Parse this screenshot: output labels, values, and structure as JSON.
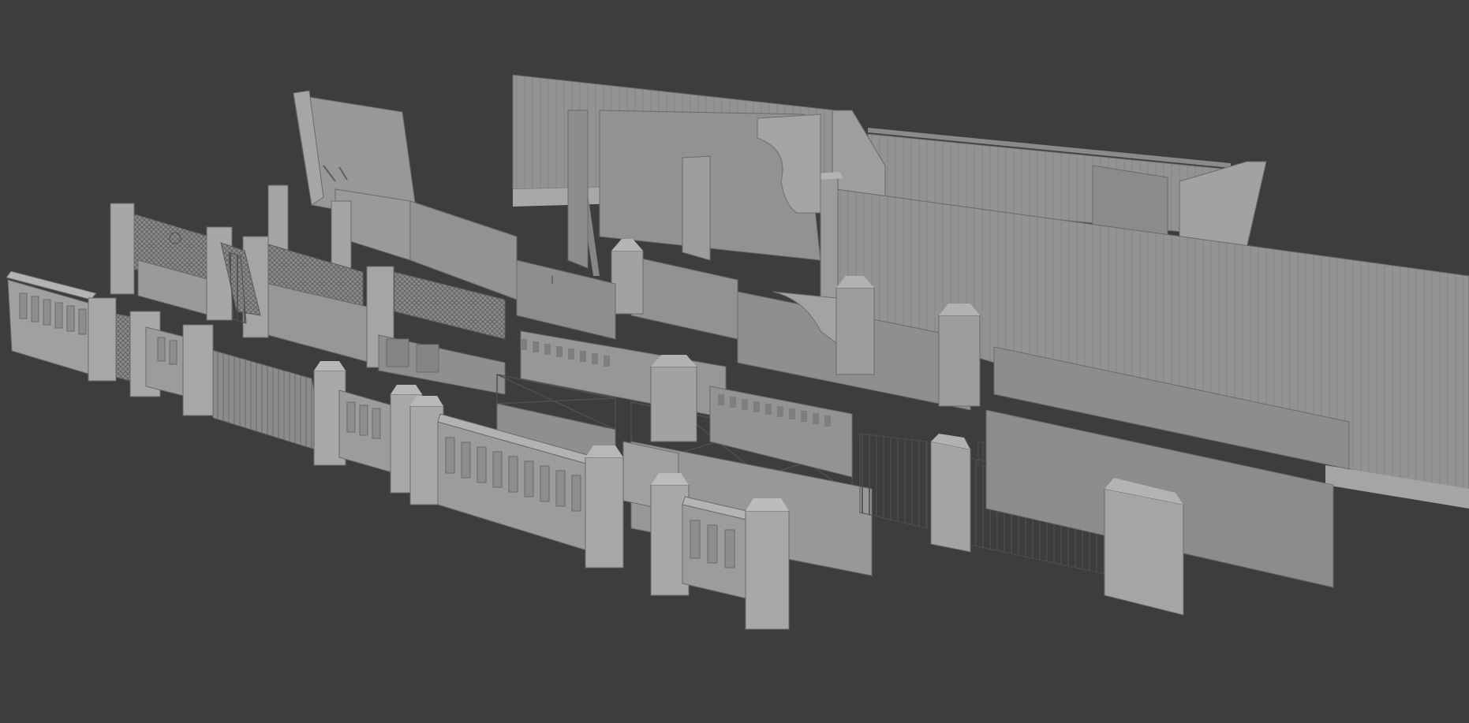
{
  "viewport": {
    "background": "#3d3d3d",
    "shade_colors": {
      "wall_light": "#9a9a9a",
      "wall_mid": "#8f8f8f",
      "wall_dark": "#7f7f7f",
      "wall_shadow": "#6e6e6e",
      "edge": "#5a5a5a",
      "pillar_top": "#b0b0b0"
    }
  },
  "scene": {
    "objects": [
      "corrugated-panel-back",
      "tall-corrugated-fence-right",
      "spiked-metal-fence-back",
      "broken-plaster-wall",
      "lattice-gate-left",
      "mesh-panel-fence",
      "baluster-railing-front",
      "wrought-iron-gate-right",
      "cross-brace-railing",
      "diagonal-picket-fence"
    ]
  }
}
